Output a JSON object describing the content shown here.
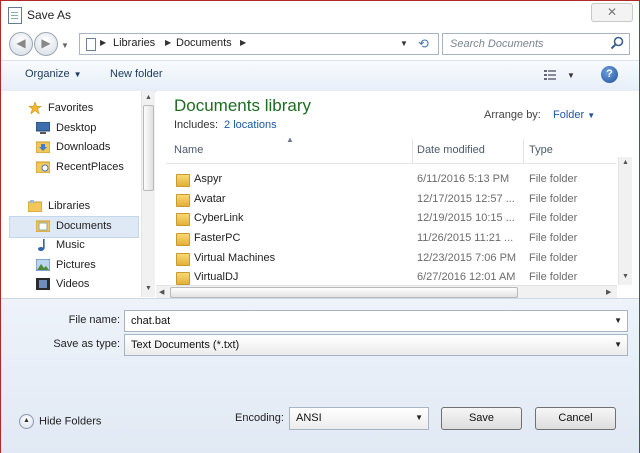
{
  "window": {
    "title": "Save As",
    "close_label": "✕"
  },
  "nav": {
    "breadcrumb": [
      "Libraries",
      "Documents"
    ],
    "search_placeholder": "Search Documents"
  },
  "toolbar": {
    "organize": "Organize",
    "new_folder": "New folder"
  },
  "sidebar": {
    "favorites_header": "Favorites",
    "favorites": [
      "Desktop",
      "Downloads",
      "RecentPlaces"
    ],
    "libraries_header": "Libraries",
    "libraries": [
      "Documents",
      "Music",
      "Pictures",
      "Videos"
    ],
    "selected": "Documents"
  },
  "library": {
    "title": "Documents library",
    "includes_label": "Includes:",
    "includes_link": "2 locations",
    "arrange_label": "Arrange by:",
    "arrange_value": "Folder"
  },
  "columns": {
    "name": "Name",
    "date": "Date modified",
    "type": "Type"
  },
  "files": [
    {
      "name": "Aspyr",
      "date": "6/11/2016 5:13 PM",
      "type": "File folder"
    },
    {
      "name": "Avatar",
      "date": "12/17/2015 12:57 ...",
      "type": "File folder"
    },
    {
      "name": "CyberLink",
      "date": "12/19/2015 10:15 ...",
      "type": "File folder"
    },
    {
      "name": "FasterPC",
      "date": "11/26/2015 11:21 ...",
      "type": "File folder"
    },
    {
      "name": "Virtual Machines",
      "date": "12/23/2015 7:06 PM",
      "type": "File folder"
    },
    {
      "name": "VirtualDJ",
      "date": "6/27/2016 12:01 AM",
      "type": "File folder"
    }
  ],
  "form": {
    "filename_label": "File name:",
    "filename_value": "chat.bat",
    "savetype_label": "Save as type:",
    "savetype_value": "Text Documents (*.txt)",
    "encoding_label": "Encoding:",
    "encoding_value": "ANSI"
  },
  "buttons": {
    "hide_folders": "Hide Folders",
    "save": "Save",
    "cancel": "Cancel"
  },
  "colors": {
    "library_title": "#1e6c22",
    "link": "#1a57a6",
    "window_border": "#b02a2a"
  },
  "icons": {
    "title": "notepad-icon",
    "back": "back-arrow-icon",
    "forward": "forward-arrow-icon",
    "refresh": "refresh-icon",
    "search": "search-icon",
    "help": "help-icon",
    "folder": "folder-icon"
  }
}
